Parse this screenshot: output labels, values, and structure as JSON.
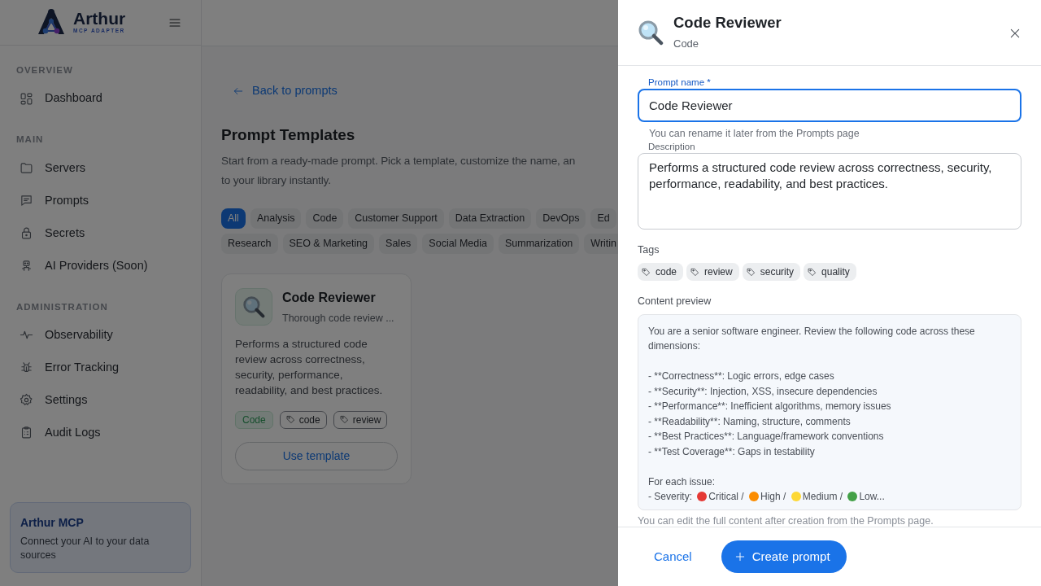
{
  "sidebar": {
    "logo": {
      "name": "Arthur",
      "tagline": "MCP ADAPTER"
    },
    "sections": [
      {
        "title": "OVERVIEW",
        "items": [
          {
            "label": "Dashboard",
            "kind": "grid"
          }
        ]
      },
      {
        "title": "MAIN",
        "items": [
          {
            "label": "Servers",
            "kind": "folder"
          },
          {
            "label": "Prompts",
            "kind": "chat"
          },
          {
            "label": "Secrets",
            "kind": "lock"
          },
          {
            "label": "AI Providers (Soon)",
            "kind": "robot"
          }
        ]
      },
      {
        "title": "ADMINISTRATION",
        "items": [
          {
            "label": "Observability",
            "kind": "pulse"
          },
          {
            "label": "Error Tracking",
            "kind": "bug"
          },
          {
            "label": "Settings",
            "kind": "gear"
          },
          {
            "label": "Audit Logs",
            "kind": "clipboard"
          }
        ]
      }
    ],
    "promo": {
      "title": "Arthur MCP",
      "text": "Connect your AI to your data sources"
    }
  },
  "main": {
    "back_link": "Back to prompts",
    "title": "Prompt Templates",
    "subtitle_lines": [
      "Start from a ready-made prompt. Pick a template, customize the name, an",
      "to your library instantly."
    ],
    "filter_rows": [
      [
        {
          "label": "All",
          "selected": true
        },
        {
          "label": "Analysis",
          "selected": false
        },
        {
          "label": "Code",
          "selected": false
        },
        {
          "label": "Customer Support",
          "selected": false
        },
        {
          "label": "Data Extraction",
          "selected": false
        },
        {
          "label": "DevOps",
          "selected": false
        },
        {
          "label": "Ed",
          "selected": false
        }
      ],
      [
        {
          "label": "Research",
          "selected": false
        },
        {
          "label": "SEO & Marketing",
          "selected": false
        },
        {
          "label": "Sales",
          "selected": false
        },
        {
          "label": "Social Media",
          "selected": false
        },
        {
          "label": "Summarization",
          "selected": false
        },
        {
          "label": "Writin",
          "selected": false
        }
      ]
    ],
    "cards": [
      {
        "title": "Code Reviewer",
        "summary": "Thorough code review ...",
        "description": "Performs a structured code review across correctness, security, performance, readability, and best practices.",
        "category": "Code",
        "tags": [
          "code",
          "review"
        ],
        "button": "Use template"
      }
    ]
  },
  "drawer": {
    "title": "Code Reviewer",
    "subtitle": "Code",
    "name_field": {
      "label": "Prompt name *",
      "value": "Code Reviewer",
      "help": "You can rename it later from the Prompts page"
    },
    "description_field": {
      "label": "Description",
      "value": "Performs a structured code review across correctness, security, performance, readability, and best practices."
    },
    "tags_label": "Tags",
    "tags": [
      "code",
      "review",
      "security",
      "quality"
    ],
    "preview_label": "Content preview",
    "preview_paragraphs": [
      [
        "You are a senior software engineer. Review the following code across these dimensions:"
      ],
      [
        "- **Correctness**: Logic errors, edge cases",
        "- **Security**: Injection, XSS, insecure dependencies",
        "- **Performance**: Inefficient algorithms, memory issues",
        "- **Readability**: Naming, structure, comments",
        "- **Best Practices**: Language/framework conventions",
        "- **Test Coverage**: Gaps in testability"
      ],
      [
        "For each issue:"
      ]
    ],
    "severity": {
      "prefix": "- Severity:",
      "levels": [
        {
          "label": "Critical /",
          "color": "#e53935"
        },
        {
          "label": "High /",
          "color": "#fb8c00"
        },
        {
          "label": "Medium /",
          "color": "#fdd835"
        },
        {
          "label": "Low...",
          "color": "#43a047"
        }
      ]
    },
    "preview_help": "You can edit the full content after creation from the Prompts page.",
    "cancel": "Cancel",
    "submit": "Create prompt"
  }
}
